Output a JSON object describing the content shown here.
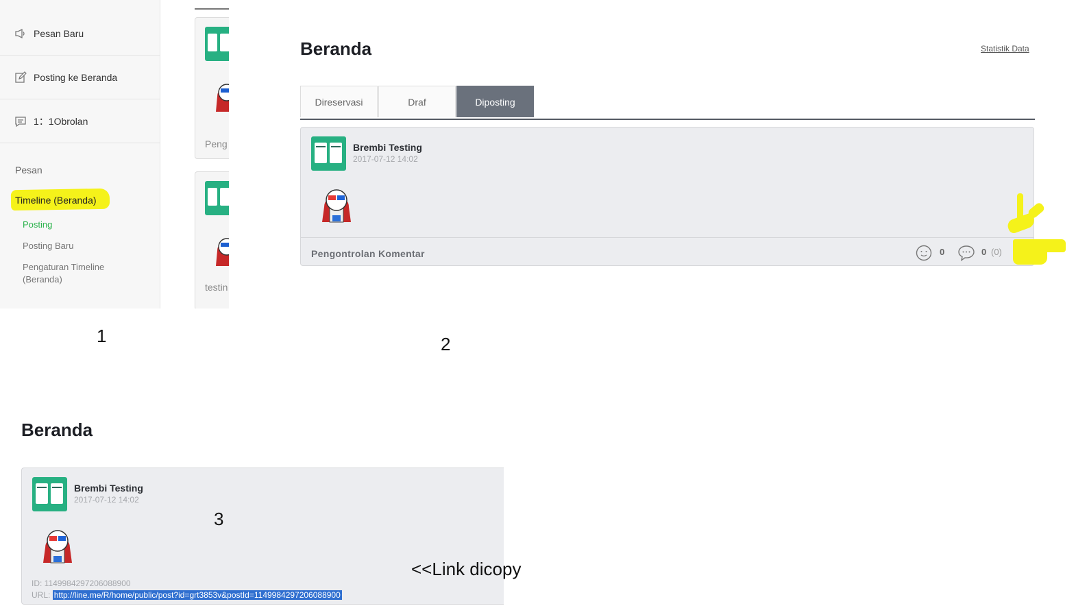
{
  "sidebar": {
    "items": [
      {
        "label": "Pesan Baru",
        "icon": "megaphone-icon"
      },
      {
        "label": "Posting ke Beranda",
        "icon": "edit-icon"
      },
      {
        "label": "1：1Obrolan",
        "icon": "chat-icon"
      }
    ],
    "section_label": "Pesan",
    "timeline_label": "Timeline (Beranda)",
    "sub_items": [
      "Posting",
      "Posting Baru",
      "Pengaturan Timeline (Beranda)"
    ]
  },
  "list_partial": {
    "texts": [
      "Peng",
      "testin"
    ]
  },
  "panel2": {
    "title": "Beranda",
    "stats_link": "Statistik Data",
    "tabs": [
      "Direservasi",
      "Draf",
      "Diposting"
    ],
    "active_tab": "Diposting",
    "post": {
      "author": "Brembi Testing",
      "date": "2017-07-12 14:02",
      "comment_control": "Pengontrolan Komentar",
      "likes": "0",
      "comments": "0",
      "comments_paren": "(0)",
      "chevron": "›"
    }
  },
  "panel3": {
    "title": "Beranda",
    "post": {
      "author": "Brembi Testing",
      "date": "2017-07-12 14:02",
      "id_line": "ID: 1149984297206088900",
      "url_prefix": "URL:",
      "url": "http://line.me/R/home/public/post?id=grt3853v&postId=1149984297206088900"
    }
  },
  "annotations": {
    "num1": "1",
    "num2": "2",
    "num3": "3",
    "note": "<<Link dicopy"
  },
  "colors": {
    "highlight": "#f5f21a",
    "accent_green": "#2ab24b",
    "thumb_green": "#27b082",
    "tab_active": "#6a717c",
    "selection": "#2f6fd0"
  }
}
